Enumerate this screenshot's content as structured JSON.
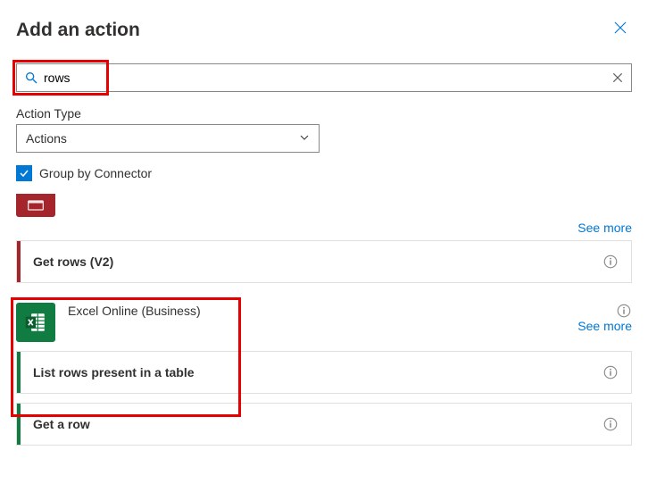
{
  "header": {
    "title": "Add an action"
  },
  "search": {
    "value": "rows"
  },
  "actionType": {
    "label": "Action Type",
    "selected": "Actions"
  },
  "groupBy": {
    "label": "Group by Connector",
    "checked": true
  },
  "seeMore": "See more",
  "connectors": {
    "sql": {
      "actions": [
        {
          "label": "Get rows (V2)"
        }
      ]
    },
    "excel": {
      "title": "Excel Online (Business)",
      "actions": [
        {
          "label": "List rows present in a table"
        },
        {
          "label": "Get a row"
        }
      ]
    }
  }
}
